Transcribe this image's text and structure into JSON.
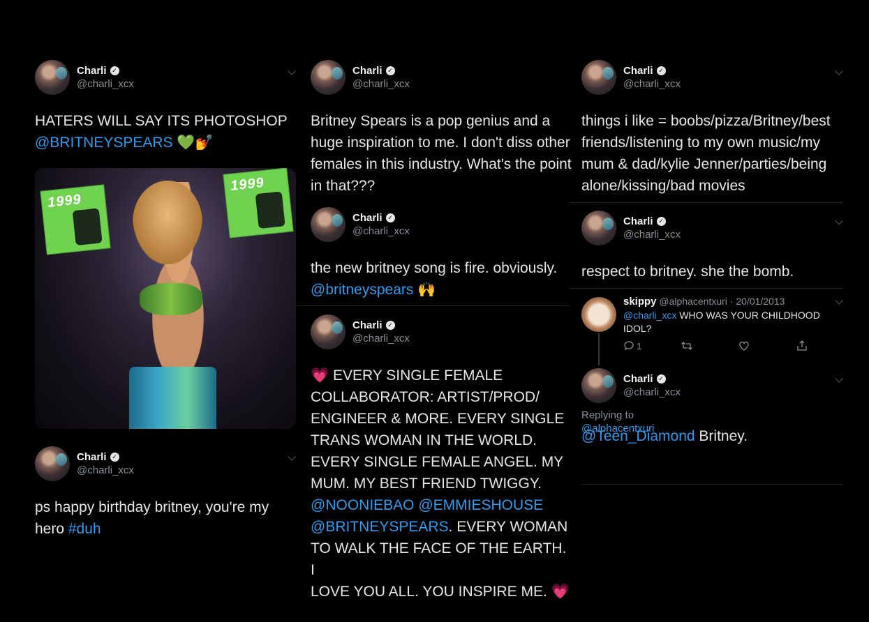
{
  "user": {
    "name": "Charli",
    "handle": "@charli_xcx",
    "verified_mark": "✓"
  },
  "col1": {
    "tweet1": {
      "text": "HATERS WILL SAY ITS PHOTOSHOP",
      "mention": "@BRITNEYSPEARS",
      "emoji": "💚💅",
      "cover_text": "1999"
    },
    "tweet2": {
      "text_a": "ps happy birthday britney, you're my",
      "text_b": "hero",
      "hashtag": "#duh"
    }
  },
  "col2": {
    "tweet1": {
      "lines": [
        "Britney Spears is a pop genius and a",
        "huge inspiration to me. I don't diss other",
        "females in this industry. What's the point",
        "in that???"
      ]
    },
    "tweet2": {
      "line1": "the new britney song is fire. obviously.",
      "mention": "@britneyspears",
      "emoji": "🙌"
    },
    "tweet3": {
      "lines": [
        "💗 EVERY SINGLE FEMALE",
        "COLLABORATOR: ARTIST/PROD/",
        "ENGINEER & MORE. EVERY SINGLE",
        "TRANS WOMAN IN THE WORLD.",
        "EVERY SINGLE FEMALE ANGEL. MY",
        "MUM. MY BEST FRIEND TWIGGY."
      ],
      "mentions1": "@NOONIEBAO @EMMIESHOUSE",
      "mention2": "@BRITNEYSPEARS",
      "after_mention2": ". EVERY WOMAN",
      "lines_end": [
        "TO WALK THE FACE OF THE EARTH. I",
        "LOVE YOU ALL. YOU INSPIRE ME. 💗"
      ]
    }
  },
  "col3": {
    "tweet1": {
      "lines": [
        "things i like = boobs/pizza/Britney/best",
        "friends/listening to my own music/my",
        "mum & dad/kylie Jenner/parties/being",
        "alone/kissing/bad movies"
      ]
    },
    "tweet2": {
      "text": "respect to britney. she the bomb."
    },
    "reply": {
      "name": "skippy",
      "handle_date": "@alphacentxuri · 20/01/2013",
      "mention": "@charli_xcx",
      "text_a": "WHO WAS YOUR CHILDHOOD",
      "text_b": "IDOL?",
      "reply_count": "1"
    },
    "tweet3": {
      "replying_label": "Replying to",
      "replying_handle": "@alphacentxuri",
      "mention": "@Teen_Diamond",
      "text": " Britney."
    }
  },
  "colors": {
    "background": "#000000",
    "link": "#2d9cf0",
    "text": "#e6e6e6",
    "muted": "#8a8f95"
  }
}
